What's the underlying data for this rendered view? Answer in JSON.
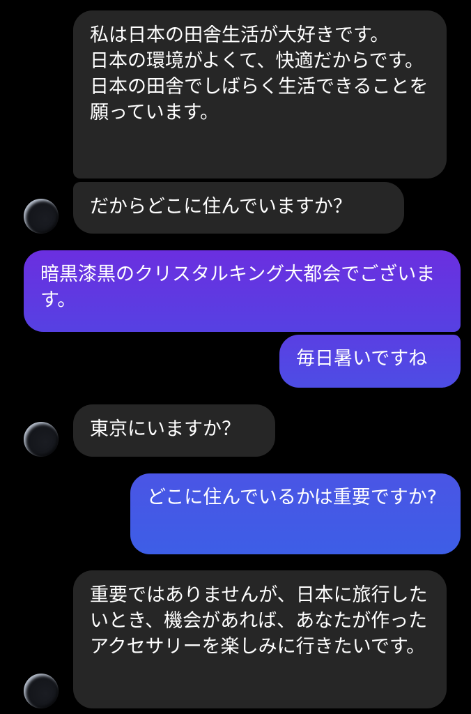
{
  "conversation": {
    "messages": [
      {
        "sender": "other",
        "text": "私は日本の田舎生活が大好きです。\n日本の環境がよくて、快適だからです。\n日本の田舎でしばらく生活できることを願っています。"
      },
      {
        "sender": "other",
        "text": "だからどこに住んでいますか？"
      },
      {
        "sender": "self",
        "text": "暗黒漆黒のクリスタルキング大都会でございます。"
      },
      {
        "sender": "self",
        "text": "毎日暑いですね"
      },
      {
        "sender": "other",
        "text": "東京にいますか？"
      },
      {
        "sender": "self",
        "text": "どこに住んでいるかは重要ですか?"
      },
      {
        "sender": "other",
        "text": "重要ではありませんが、日本に旅行したいとき、機会があれば、あなたが作ったアクセサリーを楽しみに行きたいです。"
      }
    ]
  },
  "colors": {
    "background": "#000000",
    "incoming_bubble": "#262626",
    "outgoing_gradient_top": "#6b2fe0",
    "outgoing_gradient_bottom": "#3d5ee6",
    "text": "#ffffff"
  }
}
